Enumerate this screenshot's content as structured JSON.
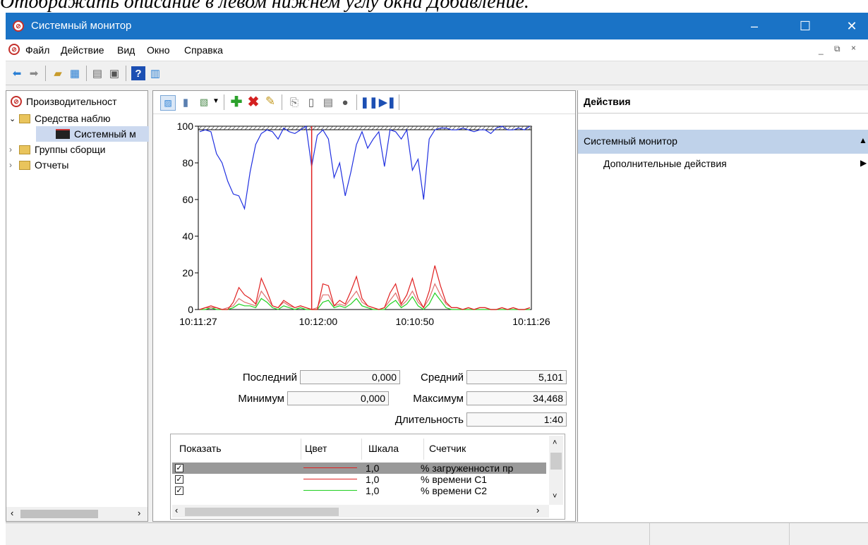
{
  "caption": "Отображать описание в левом нижнем углу окна Добавление.",
  "window": {
    "title": "Системный монитор"
  },
  "menu": [
    "Файл",
    "Действие",
    "Вид",
    "Окно",
    "Справка"
  ],
  "tree": {
    "root": "Производительност",
    "monitoring": "Средства наблю",
    "sysmon": "Системный м",
    "collectors": "Группы сборщи",
    "reports": "Отчеты"
  },
  "actions": {
    "header": "Действия",
    "section": "Системный монитор",
    "more": "Дополнительные действия"
  },
  "stats": {
    "last_label": "Последний",
    "last_value": "0,000",
    "avg_label": "Средний",
    "avg_value": "5,101",
    "min_label": "Минимум",
    "min_value": "0,000",
    "max_label": "Максимум",
    "max_value": "34,468",
    "dur_label": "Длительность",
    "dur_value": "1:40"
  },
  "table": {
    "headers": [
      "Показать",
      "Цвет",
      "Шкала",
      "Счетчик"
    ],
    "rows": [
      {
        "scale": "1,0",
        "counter": "% загруженности пр",
        "color": "#e02020"
      },
      {
        "scale": "1,0",
        "counter": "% времени C1",
        "color": "#e02020"
      },
      {
        "scale": "1,0",
        "counter": "% времени C2",
        "color": "#20d020"
      }
    ]
  },
  "chart_data": {
    "type": "line",
    "ylim": [
      0,
      100
    ],
    "yticks": [
      "100",
      "80",
      "60",
      "40",
      "20",
      "0"
    ],
    "xticks": [
      "10:11:27",
      "10:12:00",
      "10:10:50",
      "10:11:26"
    ],
    "cursor_index": 20,
    "series": [
      {
        "color": "#2030e0",
        "values": [
          97,
          98,
          97,
          85,
          80,
          70,
          63,
          62,
          55,
          75,
          90,
          96,
          98,
          97,
          93,
          99,
          97,
          96,
          98,
          100,
          78,
          95,
          98,
          93,
          72,
          80,
          62,
          75,
          90,
          97,
          88,
          93,
          97,
          78,
          98,
          97,
          93,
          98,
          76,
          82,
          60,
          93,
          98,
          99,
          99,
          98,
          98,
          99,
          98,
          97,
          98,
          98,
          96,
          99,
          100,
          98,
          98,
          99,
          98,
          100
        ]
      },
      {
        "color": "#e02020",
        "values": [
          0,
          1,
          2,
          1,
          0,
          0,
          4,
          12,
          8,
          6,
          3,
          17,
          10,
          2,
          1,
          5,
          3,
          1,
          2,
          1,
          0,
          0,
          14,
          13,
          2,
          5,
          3,
          10,
          18,
          6,
          2,
          1,
          0,
          1,
          9,
          14,
          3,
          8,
          17,
          6,
          1,
          10,
          24,
          13,
          4,
          1,
          1,
          0,
          1,
          0,
          1,
          1,
          0,
          0,
          1,
          0,
          1,
          0,
          0,
          1
        ]
      },
      {
        "color": "#e07070",
        "values": [
          0,
          1,
          1,
          1,
          0,
          1,
          2,
          6,
          4,
          3,
          2,
          10,
          6,
          2,
          1,
          4,
          2,
          1,
          2,
          1,
          0,
          1,
          8,
          8,
          2,
          3,
          2,
          6,
          10,
          4,
          2,
          1,
          0,
          1,
          5,
          9,
          2,
          5,
          10,
          4,
          1,
          6,
          14,
          8,
          3,
          1,
          1,
          0,
          1,
          0,
          1,
          1,
          0,
          0,
          1,
          0,
          1,
          0,
          0,
          1
        ]
      },
      {
        "color": "#20d020",
        "values": [
          0,
          0,
          1,
          0,
          0,
          0,
          1,
          3,
          2,
          2,
          1,
          6,
          4,
          1,
          0,
          2,
          1,
          0,
          1,
          0,
          0,
          0,
          4,
          5,
          1,
          2,
          1,
          3,
          6,
          2,
          1,
          0,
          0,
          0,
          3,
          5,
          1,
          3,
          7,
          2,
          0,
          3,
          9,
          5,
          1,
          0,
          0,
          0,
          0,
          0,
          0,
          0,
          0,
          0,
          0,
          0,
          0,
          0,
          0,
          0
        ]
      }
    ]
  }
}
